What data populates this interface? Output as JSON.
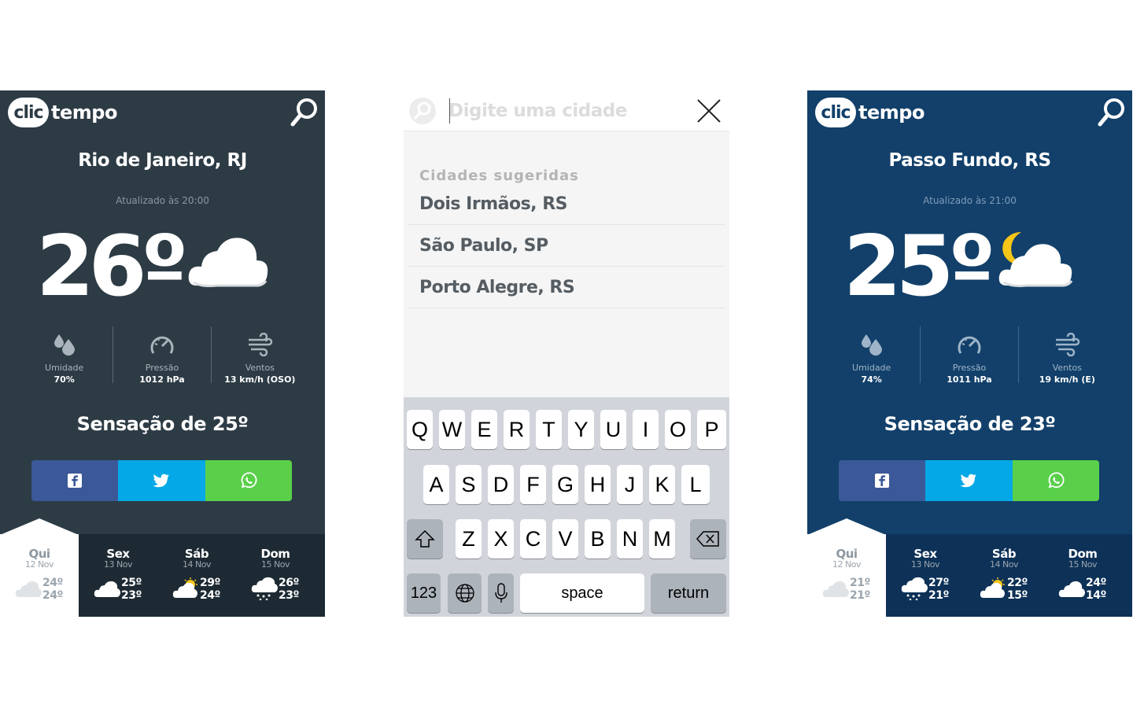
{
  "brand": {
    "clic": "clic",
    "tempo": "tempo"
  },
  "left": {
    "city": "Rio de Janeiro, RJ",
    "updated": "Atualizado às 20:00",
    "temp": "26º",
    "stats": [
      {
        "label": "Umidade",
        "value": "70%"
      },
      {
        "label": "Pressão",
        "value": "1012 hPa"
      },
      {
        "label": "Ventos",
        "value": "13 km/h (OSO)"
      }
    ],
    "feels": "Sensação de 25º",
    "forecast": [
      {
        "day": "Qui",
        "date": "12 Nov",
        "max": "24º",
        "min": "24º",
        "icon": "cloud-icon"
      },
      {
        "day": "Sex",
        "date": "13 Nov",
        "max": "25º",
        "min": "23º",
        "icon": "cloud-icon"
      },
      {
        "day": "Sáb",
        "date": "14 Nov",
        "max": "29º",
        "min": "24º",
        "icon": "sun-cloud-icon"
      },
      {
        "day": "Dom",
        "date": "15 Nov",
        "max": "26º",
        "min": "23º",
        "icon": "rain-cloud-icon"
      }
    ]
  },
  "middle": {
    "placeholder": "Digite uma cidade",
    "suggest_title": "Cidades sugeridas",
    "suggestions": [
      "Dois Irmãos, RS",
      "São Paulo, SP",
      "Porto Alegre, RS"
    ],
    "keyboard": {
      "row1": [
        "Q",
        "W",
        "E",
        "R",
        "T",
        "Y",
        "U",
        "I",
        "O",
        "P"
      ],
      "row2": [
        "A",
        "S",
        "D",
        "F",
        "G",
        "H",
        "J",
        "K",
        "L"
      ],
      "row3": [
        "Z",
        "X",
        "C",
        "V",
        "B",
        "N",
        "M"
      ],
      "numbers": "123",
      "space": "space",
      "return": "return"
    }
  },
  "right": {
    "city": "Passo Fundo, RS",
    "updated": "Atualizado às 21:00",
    "temp": "25º",
    "stats": [
      {
        "label": "Umidade",
        "value": "74%"
      },
      {
        "label": "Pressão",
        "value": "1011 hPa"
      },
      {
        "label": "Ventos",
        "value": "19 km/h (E)"
      }
    ],
    "feels": "Sensação de 23º",
    "forecast": [
      {
        "day": "Qui",
        "date": "12 Nov",
        "max": "21º",
        "min": "21º",
        "icon": "cloud-icon"
      },
      {
        "day": "Sex",
        "date": "13 Nov",
        "max": "27º",
        "min": "21º",
        "icon": "rain-cloud-icon"
      },
      {
        "day": "Sáb",
        "date": "14 Nov",
        "max": "22º",
        "min": "15º",
        "icon": "sun-cloud-icon"
      },
      {
        "day": "Dom",
        "date": "15 Nov",
        "max": "24º",
        "min": "14º",
        "icon": "cloud-icon"
      }
    ]
  },
  "colors": {
    "left_bg": "#2d3b45",
    "right_bg": "#12406a",
    "facebook": "#3b5998",
    "twitter": "#05a8e6",
    "whatsapp": "#5ad04a"
  }
}
